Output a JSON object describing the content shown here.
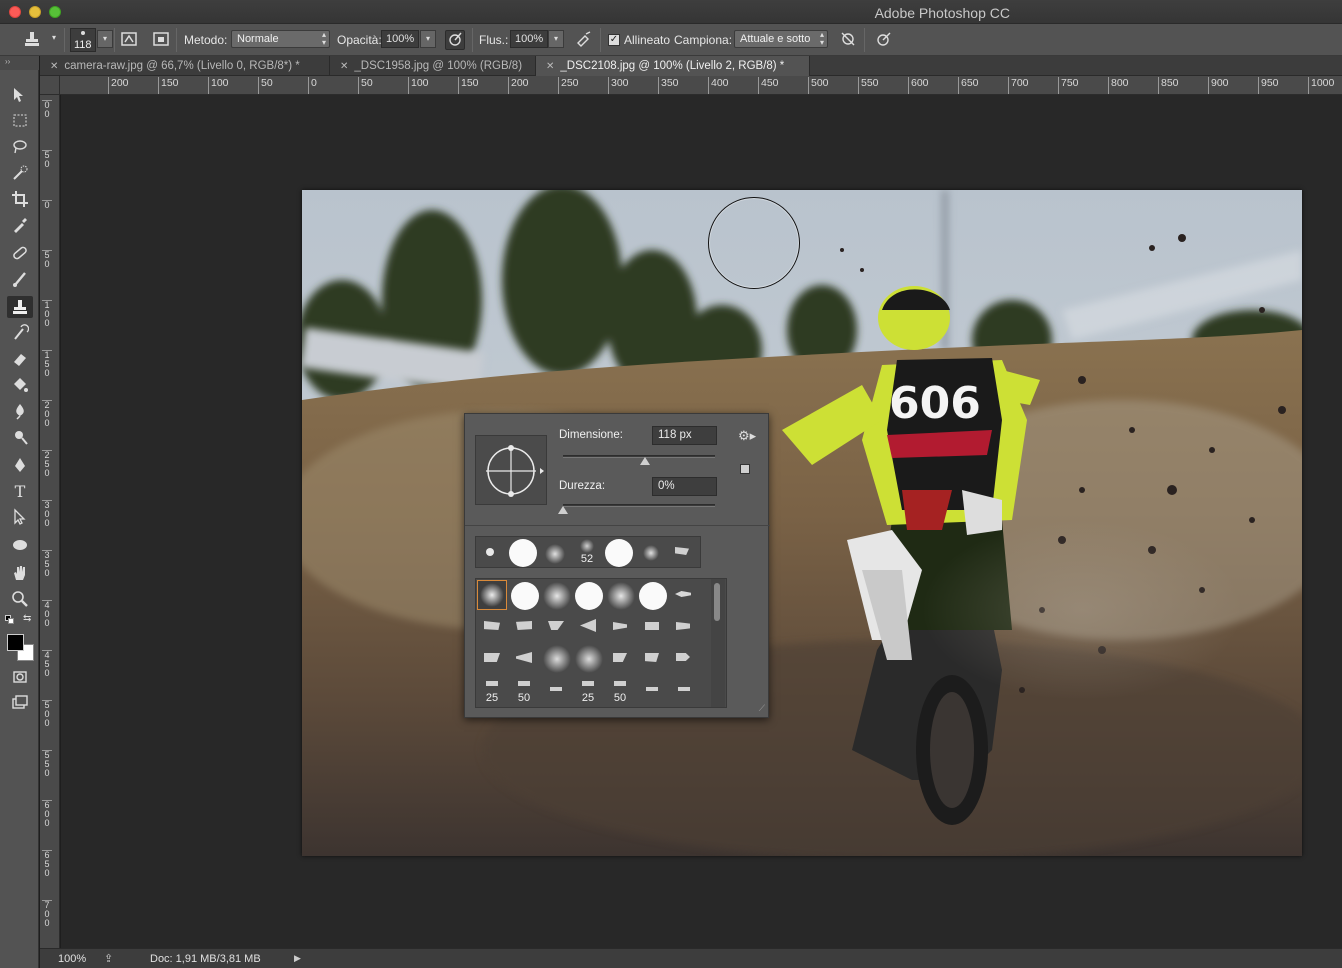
{
  "app": {
    "title": "Adobe Photoshop CC"
  },
  "options": {
    "brush_size": "118",
    "metodo_label": "Metodo:",
    "metodo_value": "Normale",
    "opacita_label": "Opacità:",
    "opacita_value": "100%",
    "flusso_label": "Flus.:",
    "flusso_value": "100%",
    "allineato_label": "Allineato",
    "allineato_checked": true,
    "campiona_label": "Campiona:",
    "campiona_value": "Attuale e sotto"
  },
  "tabs": [
    {
      "label": "camera-raw.jpg @ 66,7% (Livello 0, RGB/8*) *",
      "active": false
    },
    {
      "label": "_DSC1958.jpg @ 100% (RGB/8)",
      "active": false
    },
    {
      "label": "_DSC2108.jpg @ 100% (Livello 2, RGB/8) *",
      "active": true
    }
  ],
  "ruler_h": [
    "200",
    "150",
    "100",
    "50",
    "0",
    "50",
    "100",
    "150",
    "200",
    "250",
    "300",
    "350",
    "400",
    "450",
    "500",
    "550",
    "600",
    "650",
    "700",
    "750",
    "800",
    "850",
    "900",
    "950",
    "1000"
  ],
  "ruler_v": [
    "0",
    "5",
    "0",
    "5",
    "1",
    "1",
    "2",
    "2",
    "3",
    "3",
    "4",
    "4",
    "5",
    "5",
    "6",
    "6",
    "7",
    "7"
  ],
  "ruler_v_full": [
    "00",
    "50",
    "0",
    "50",
    "100",
    "150",
    "200",
    "250",
    "300",
    "350",
    "400",
    "450",
    "500",
    "550",
    "600",
    "650",
    "700",
    "7"
  ],
  "brush_panel": {
    "size_label": "Dimensione:",
    "size_value": "118 px",
    "size_fraction": 0.54,
    "hardness_label": "Durezza:",
    "hardness_value": "0%",
    "hardness_fraction": 0.0,
    "recent_label_52": "52",
    "grid_labels": [
      "25",
      "50",
      "25",
      "50"
    ]
  },
  "status": {
    "zoom": "100%",
    "doc": "Doc: 1,91 MB/3,81 MB"
  },
  "icons": {
    "stamp": "clone-stamp-icon",
    "close": "close-icon"
  }
}
